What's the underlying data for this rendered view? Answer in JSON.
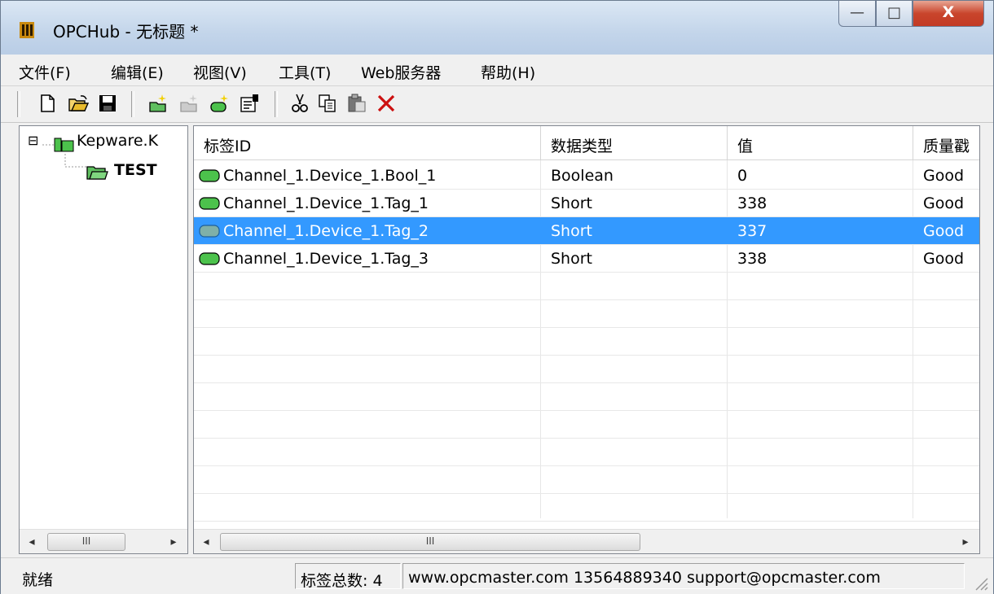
{
  "window": {
    "title": "OPCHub - 无标题 *"
  },
  "controls": {
    "minimize": "—",
    "maximize": "□",
    "close": "X"
  },
  "menu": [
    "文件(F)",
    "编辑(E)",
    "视图(V)",
    "工具(T)",
    "Web服务器",
    "帮助(H)"
  ],
  "toolbar": [
    "new-icon",
    "open-icon",
    "save-icon",
    "add-group-icon",
    "edit-group-icon",
    "add-tag-icon",
    "properties-icon",
    "cut-icon",
    "copy-icon",
    "paste-icon",
    "delete-icon"
  ],
  "tree": {
    "root": {
      "expander": "⊟",
      "label": "Kepware.K"
    },
    "child": {
      "label": "TEST"
    }
  },
  "table": {
    "headers": [
      "标签ID",
      "数据类型",
      "值",
      "质量戳"
    ],
    "rows": [
      {
        "id": "Channel_1.Device_1.Bool_1",
        "type": "Boolean",
        "value": "0",
        "quality": "Good"
      },
      {
        "id": "Channel_1.Device_1.Tag_1",
        "type": "Short",
        "value": "338",
        "quality": "Good"
      },
      {
        "id": "Channel_1.Device_1.Tag_2",
        "type": "Short",
        "value": "337",
        "quality": "Good",
        "selected": true
      },
      {
        "id": "Channel_1.Device_1.Tag_3",
        "type": "Short",
        "value": "338",
        "quality": "Good"
      }
    ]
  },
  "scroll": {
    "left": "◂",
    "right": "▸",
    "thumb": "III"
  },
  "status": {
    "ready": "就绪",
    "tag_count": "标签总数: 4",
    "contact": "www.opcmaster.com 13564889340 support@opcmaster.com"
  },
  "colors": {
    "selection": "#3399ff",
    "tag_icon": "#4cc24c",
    "folder": "#5fbf5f"
  }
}
